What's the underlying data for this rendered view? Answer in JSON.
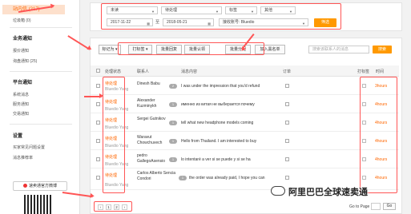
{
  "sidebar": {
    "active_item": "站内信 (217)",
    "items_top": [
      "垃圾箱 (0)"
    ],
    "sections": [
      {
        "title": "业务通知",
        "items": [
          "报价通知",
          "询盘通知 (25)"
        ]
      },
      {
        "title": "平台通知",
        "items": [
          "系统消息",
          "服务通知",
          "交易通知"
        ]
      },
      {
        "title": "设置",
        "items": [
          "买家常见问题设置",
          "消息推荐率"
        ]
      }
    ],
    "feedback_label": "速卖通官方微博"
  },
  "filters": {
    "row1": [
      "未读",
      "待处理",
      "标签",
      "其他"
    ],
    "date_from": "2017-11-22",
    "date_to": "2018-05-21",
    "date_sep": "至",
    "recipient_label": "接收账号: Bluedio",
    "search_label": "筛选"
  },
  "toolbar": {
    "mark_as": "标记为",
    "tag": "打标签",
    "batch_reply": "批量回复",
    "batch_confirm": "批量认领",
    "batch_assign": "批量分配",
    "add_blacklist": "加入黑名单",
    "search_placeholder": "搜索该联系人的消息",
    "search_btn": "搜索"
  },
  "table": {
    "headers": {
      "status": "处理状态",
      "contact": "联系人",
      "message": "消息内容",
      "order": "订单",
      "tag": "打标签",
      "time": "时间"
    },
    "rows": [
      {
        "status": "待处理",
        "owner": "Bluedio Yang",
        "name": "Dinesh Babu",
        "badge": "2",
        "message": "I was under the impression that you'd refund",
        "time": "3hours"
      },
      {
        "status": "待处理",
        "owner": "Bluedio Yang",
        "name": "Alexander Kuzminykh",
        "badge": "1",
        "message": "именно из китая не выберается почему",
        "time": "4hours"
      },
      {
        "status": "待处理",
        "owner": "Bluedio Yang",
        "name": "Sergei Gutnikov",
        "badge": "1",
        "message": "tell what new headphone models coming",
        "time": "4hours"
      },
      {
        "status": "待处理",
        "owner": "Bluedio Yang",
        "name": "Waravut Chowchuvech",
        "badge": "1",
        "message": "Hello from Thailand. I am interested to buy",
        "time": "4hours"
      },
      {
        "status": "待处理",
        "owner": "Bluedio Yang",
        "name": "pedro GallegoAsensio",
        "badge": "1",
        "message": "lo intentaré a ver si se puede y si se ha",
        "time": "4hours"
      },
      {
        "status": "待处理",
        "owner": "Bluedio Yang",
        "name": "Carlos Alberto Sencia Condori",
        "badge": "1",
        "message": "the order was already paid, I hope you can",
        "time": "4hours"
      }
    ]
  },
  "pagination": {
    "prev": "‹",
    "pages": [
      "1",
      "2"
    ],
    "next": "›",
    "goto_label": "Go to Page",
    "go_btn": "Go"
  },
  "watermark": "阿里巴巴全球速卖通",
  "colors": {
    "accent": "#ff6600",
    "annotation": "#ff5555",
    "button": "#ff9900"
  }
}
